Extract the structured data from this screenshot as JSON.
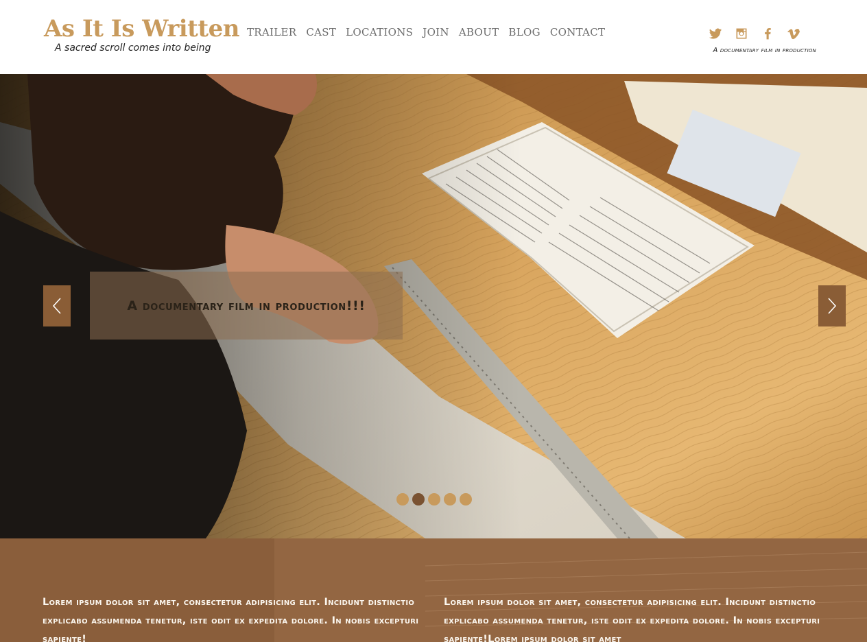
{
  "header": {
    "logo_title": "As It Is Written",
    "logo_tagline": "A sacred scroll comes into being",
    "nav": [
      "TRAILER",
      "CAST",
      "LOCATIONS",
      "JOIN",
      "ABOUT",
      "BLOG",
      "CONTACT"
    ],
    "social_icons": [
      "twitter-icon",
      "instagram-icon",
      "facebook-icon",
      "vimeo-icon"
    ],
    "tagline_right": "A documentary film in production"
  },
  "hero": {
    "caption": "A documentary film in production!!!",
    "slide_count": 5,
    "active_slide": 2,
    "prev_icon": "chevron-left-icon",
    "next_icon": "chevron-right-icon"
  },
  "content": {
    "left_text": "Lorem ipsum dolor sit amet, consectetur adipisicing elit. Incidunt distinctio explicabo assumenda tenetur, iste odit ex expedita dolore. In nobis excepturi sapiente!",
    "right_text": "Lorem ipsum dolor sit amet, consectetur adipisicing elit. Incidunt distinctio explicabo assumenda tenetur, iste odit ex expedita dolore. In nobis excepturi sapiente!Lorem ipsum dolor sit amet"
  },
  "colors": {
    "accent": "#c89a5c",
    "dark_brown": "#7a5231",
    "section_brown": "#8a5e3b"
  }
}
